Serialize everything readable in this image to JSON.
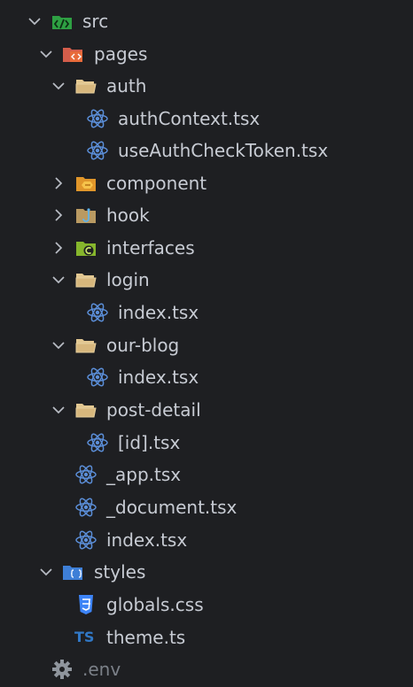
{
  "explorer": {
    "items": [
      {
        "label": "src",
        "kind": "src-folder",
        "chevron": "down"
      },
      {
        "label": "pages",
        "kind": "pages-folder",
        "chevron": "down"
      },
      {
        "label": "auth",
        "kind": "folder-open",
        "chevron": "down"
      },
      {
        "label": "authContext.tsx",
        "kind": "react-file"
      },
      {
        "label": "useAuthCheckToken.tsx",
        "kind": "react-file"
      },
      {
        "label": "component",
        "kind": "component-folder",
        "chevron": "right"
      },
      {
        "label": "hook",
        "kind": "hook-folder",
        "chevron": "right"
      },
      {
        "label": "interfaces",
        "kind": "interfaces-folder",
        "chevron": "right"
      },
      {
        "label": "login",
        "kind": "folder-open",
        "chevron": "down"
      },
      {
        "label": "index.tsx",
        "kind": "react-file"
      },
      {
        "label": "our-blog",
        "kind": "folder-open",
        "chevron": "down"
      },
      {
        "label": "index.tsx",
        "kind": "react-file"
      },
      {
        "label": "post-detail",
        "kind": "folder-open",
        "chevron": "down"
      },
      {
        "label": "[id].tsx",
        "kind": "react-file"
      },
      {
        "label": "_app.tsx",
        "kind": "react-file"
      },
      {
        "label": "_document.tsx",
        "kind": "react-file"
      },
      {
        "label": "index.tsx",
        "kind": "react-file"
      },
      {
        "label": "styles",
        "kind": "styles-folder",
        "chevron": "down"
      },
      {
        "label": "globals.css",
        "kind": "css-file"
      },
      {
        "label": "theme.ts",
        "kind": "ts-file",
        "badge": "TS"
      },
      {
        "label": ".env",
        "kind": "env-file"
      }
    ]
  },
  "colors": {
    "background": "#1e1f22",
    "text": "#c7cbd3",
    "text_dim": "#7b8088",
    "chevron": "#b8bcc4",
    "react": "#5b8ed8",
    "folder": "#d7b77d",
    "src_folder": "#2ea043",
    "pages_folder": "#e35d4a",
    "component_folder": "#f0a22d",
    "hook_folder": "#c4a56a",
    "interfaces_folder": "#8bbf2e",
    "styles_folder": "#3e7fd7",
    "css": "#3d84f7",
    "ts": "#3178c6",
    "env": "#8f959d"
  }
}
